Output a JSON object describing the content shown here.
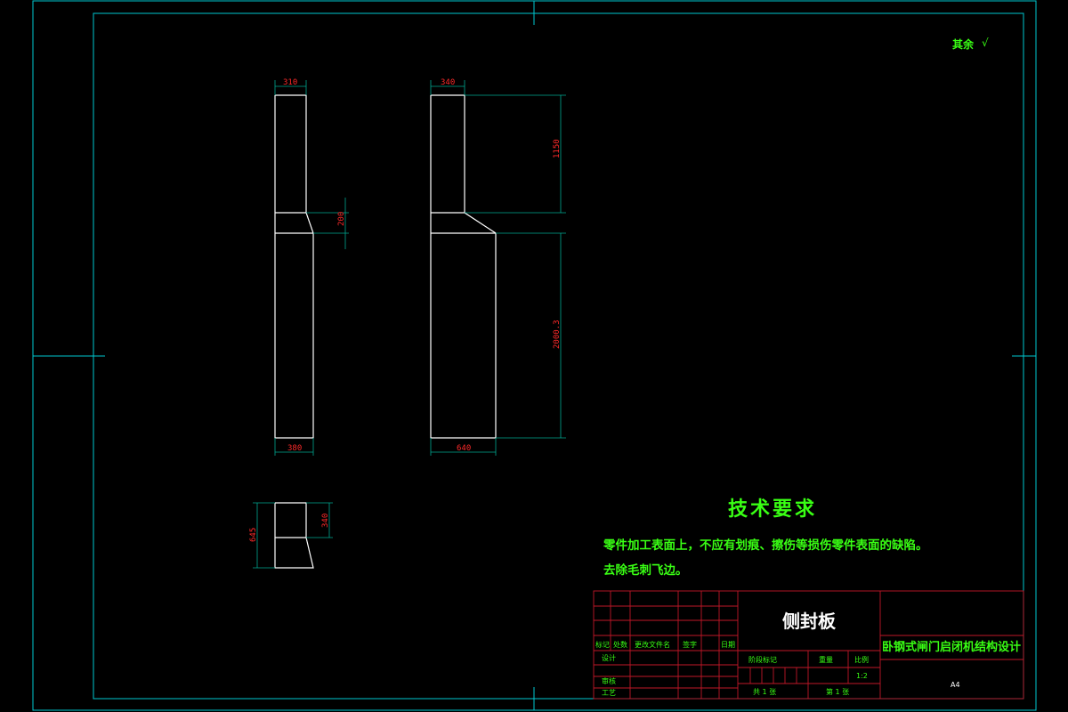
{
  "corner_note": "其余",
  "corner_symbol": "√",
  "dimensions": {
    "view1_top_width": "310",
    "view1_chamfer_height": "200",
    "view1_bottom_width": "380",
    "view2_top_width": "340",
    "view2_upper_height": "1150",
    "view2_lower_height": "2000.3",
    "view2_bottom_width": "640",
    "view3_total_height": "645",
    "view3_upper_height": "340"
  },
  "tech_requirements": {
    "heading": "技术要求",
    "line1": "零件加工表面上，不应有划痕、擦伤等损伤零件表面的缺陷。",
    "line2": "去除毛刺飞边。"
  },
  "title_block": {
    "part_name": "侧封板",
    "design_title": "卧钢式闸门启闭机结构设计",
    "col_mark": "标记",
    "col_count": "处数",
    "col_doc": "更改文件名",
    "col_sign": "签字",
    "col_date": "日期",
    "row_design": "设计",
    "row_check": "审核",
    "row_process": "工艺",
    "label_stage": "阶段标记",
    "label_weight": "重量",
    "label_scale": "比例",
    "scale": "1:2",
    "sheets_total": "共 1 张",
    "sheet_no": "第 1 张",
    "paper_size": "A4"
  }
}
